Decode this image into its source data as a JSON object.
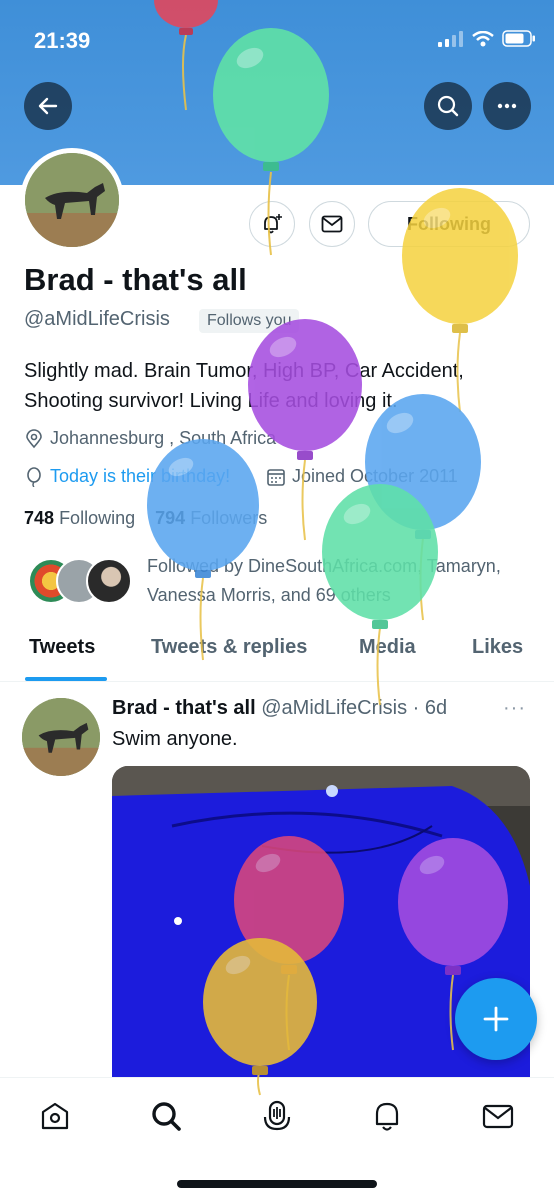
{
  "status_bar": {
    "time": "21:39"
  },
  "profile": {
    "name": "Brad - that's all",
    "handle": "@aMidLifeCrisis",
    "follows_you": "Follows you",
    "bio": "Slightly mad. Brain Tumor, High BP, Car Accident, Shooting survivor! Living Life and loving it.",
    "location": "Johannesburg , South Africa",
    "birthday": "Today is their birthday!",
    "joined": "Joined October 2011",
    "following_count": "748",
    "following_label": "Following",
    "followers_count": "794",
    "followers_label": "Followers",
    "followed_by": "Followed by DineSouthAfrica.com, Tamaryn, Vanessa Morris, and 69 others"
  },
  "actions": {
    "following_button": "Following"
  },
  "tabs": [
    {
      "label": "Tweets"
    },
    {
      "label": "Tweets & replies"
    },
    {
      "label": "Media"
    },
    {
      "label": "Likes"
    }
  ],
  "tweet": {
    "name": "Brad - that's all",
    "meta": "@aMidLifeCrisis · 6d",
    "text": "Swim anyone.",
    "more": "···"
  },
  "colors": {
    "accent": "#1d9bf0",
    "banner": "#4a96dd",
    "pool": "#1a1adb"
  }
}
